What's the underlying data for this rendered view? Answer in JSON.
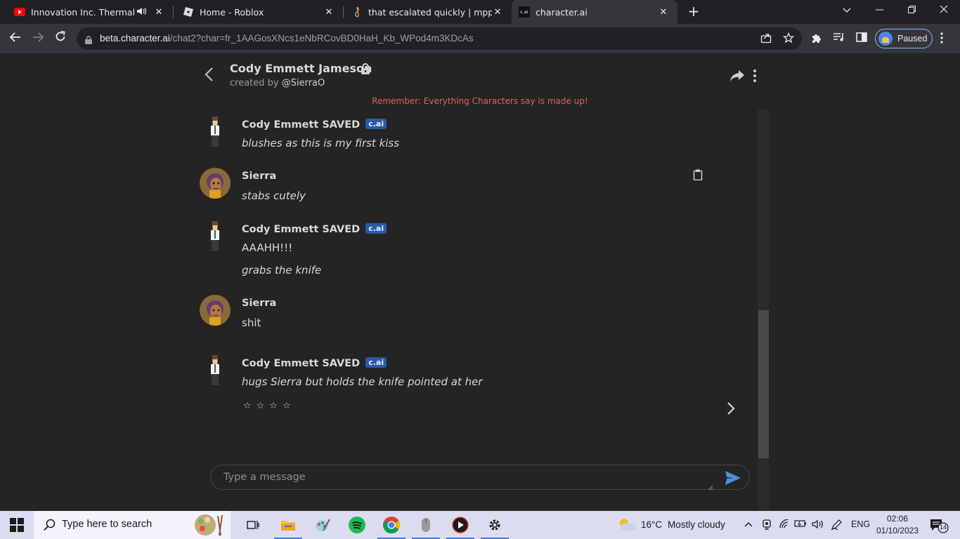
{
  "browser": {
    "tabs": [
      {
        "title": "Innovation Inc. Thermal Pow",
        "favicon": "youtube-icon",
        "audio": "◀)"
      },
      {
        "title": "Home - Roblox",
        "favicon": "roblox-icon"
      },
      {
        "title": "that escalated quickly | mpp.com",
        "favicon": "music-note-icon"
      },
      {
        "title": "character.ai",
        "favicon": "cai-icon",
        "favicon_text": "c.ai",
        "active": true
      }
    ],
    "url_host": "beta.character.ai",
    "url_path": "/chat2?char=fr_1AAGosXNcs1eNbRCovBD0HaH_Kb_WPod4m3KDcAs",
    "profile_label": "Paused"
  },
  "chat": {
    "character_name": "Cody Emmett Jameson",
    "created_by_prefix": "created by ",
    "creator_handle": "@SierraO",
    "reminder": "Remember: Everything Characters say is made up!",
    "badge": "c.ai",
    "messages": [
      {
        "sender": "Cody Emmett SAVED",
        "is_bot": true,
        "lines": [
          {
            "text": "blushes as this is my first kiss",
            "italic": true
          }
        ]
      },
      {
        "sender": "Sierra",
        "is_bot": false,
        "lines": [
          {
            "text": "stabs cutely",
            "italic": true
          }
        ]
      },
      {
        "sender": "Cody Emmett SAVED",
        "is_bot": true,
        "lines": [
          {
            "text": "AAAHH!!!",
            "italic": false
          },
          {
            "text": "grabs the knife",
            "italic": true
          }
        ]
      },
      {
        "sender": "Sierra",
        "is_bot": false,
        "lines": [
          {
            "text": "shit",
            "italic": false
          }
        ]
      },
      {
        "sender": "Cody Emmett SAVED",
        "is_bot": true,
        "lines": [
          {
            "text": "hugs Sierra but holds the knife pointed at her",
            "italic": true
          }
        ]
      }
    ],
    "rating_stars": "☆☆☆☆",
    "input_placeholder": "Type a message"
  },
  "taskbar": {
    "search_placeholder": "Type here to search",
    "weather_temp": "16°C",
    "weather_text": "Mostly cloudy",
    "language": "ENG",
    "time": "02:06",
    "date": "01/10/2023",
    "notification_count": "14"
  },
  "colors": {
    "accent": "#2a5aa8",
    "reminder": "#e0605a",
    "send": "#4a8fe0"
  }
}
